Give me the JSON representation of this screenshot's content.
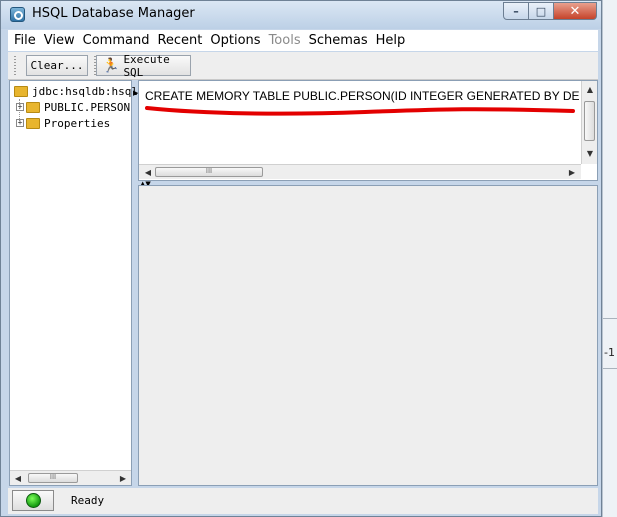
{
  "window": {
    "title": "HSQL Database Manager"
  },
  "window_controls": {
    "minimize": "–",
    "maximize": "□",
    "close": "✕"
  },
  "menu": [
    "File",
    "View",
    "Command",
    "Recent",
    "Options",
    "Tools",
    "Schemas",
    "Help"
  ],
  "toolbar": {
    "clear_label": "Clear...",
    "execute_label": "Execute SQL"
  },
  "tree": {
    "root": "jdbc:hsqldb:hsql",
    "children": [
      "PUBLIC.PERSON",
      "Properties"
    ]
  },
  "sql_editor": {
    "text": "CREATE MEMORY TABLE PUBLIC.PERSON(ID INTEGER GENERATED BY DEF",
    "annotation_color": "#e30000"
  },
  "scrollbar": {
    "grip": "III"
  },
  "status": {
    "text": "Ready",
    "indicator_color": "#1fbf1a"
  },
  "backdrop": {
    "fragment_text": "-1"
  }
}
